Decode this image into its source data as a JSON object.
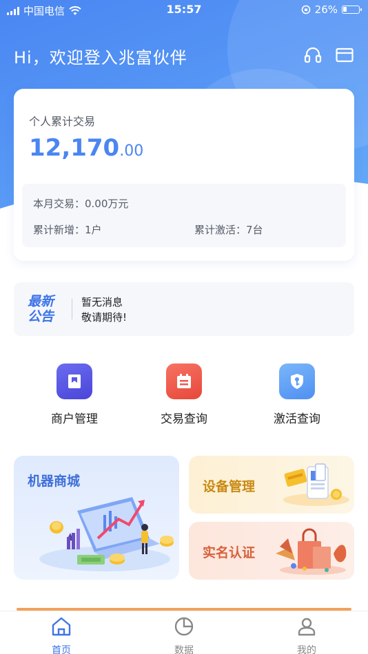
{
  "status_bar": {
    "carrier": "中国电信",
    "time": "15:57",
    "battery": "26%",
    "battery_level": 0.26
  },
  "header": {
    "greeting": "Hi，欢迎登入兆富伙伴",
    "icons": [
      "headset-icon",
      "mail-icon"
    ]
  },
  "stats": {
    "title": "个人累计交易",
    "amount_int": "12,170",
    "amount_dec": ".00",
    "monthly": "本月交易：0.00万元",
    "new_added": "累计新增：1户",
    "activated": "累计激活：7台"
  },
  "notice": {
    "tag": "最新公告",
    "line1": "暂无消息",
    "line2": "敬请期待!"
  },
  "quick_menu": [
    {
      "label": "商户管理",
      "icon": "merchant-icon",
      "color": "#5a57e6"
    },
    {
      "label": "交易查询",
      "icon": "calendar-icon",
      "color": "#ef5a4a"
    },
    {
      "label": "激活查询",
      "icon": "shield-key-icon",
      "color": "#5a9cf6"
    }
  ],
  "tiles": {
    "mall": "机器商城",
    "device": "设备管理",
    "realname": "实名认证"
  },
  "tabbar": [
    {
      "label": "首页",
      "icon": "home-icon",
      "active": true
    },
    {
      "label": "数据",
      "icon": "pie-chart-icon",
      "active": false
    },
    {
      "label": "我的",
      "icon": "user-icon",
      "active": false
    }
  ],
  "colors": {
    "primary": "#4a86f2",
    "tag": "#3e74e8"
  }
}
